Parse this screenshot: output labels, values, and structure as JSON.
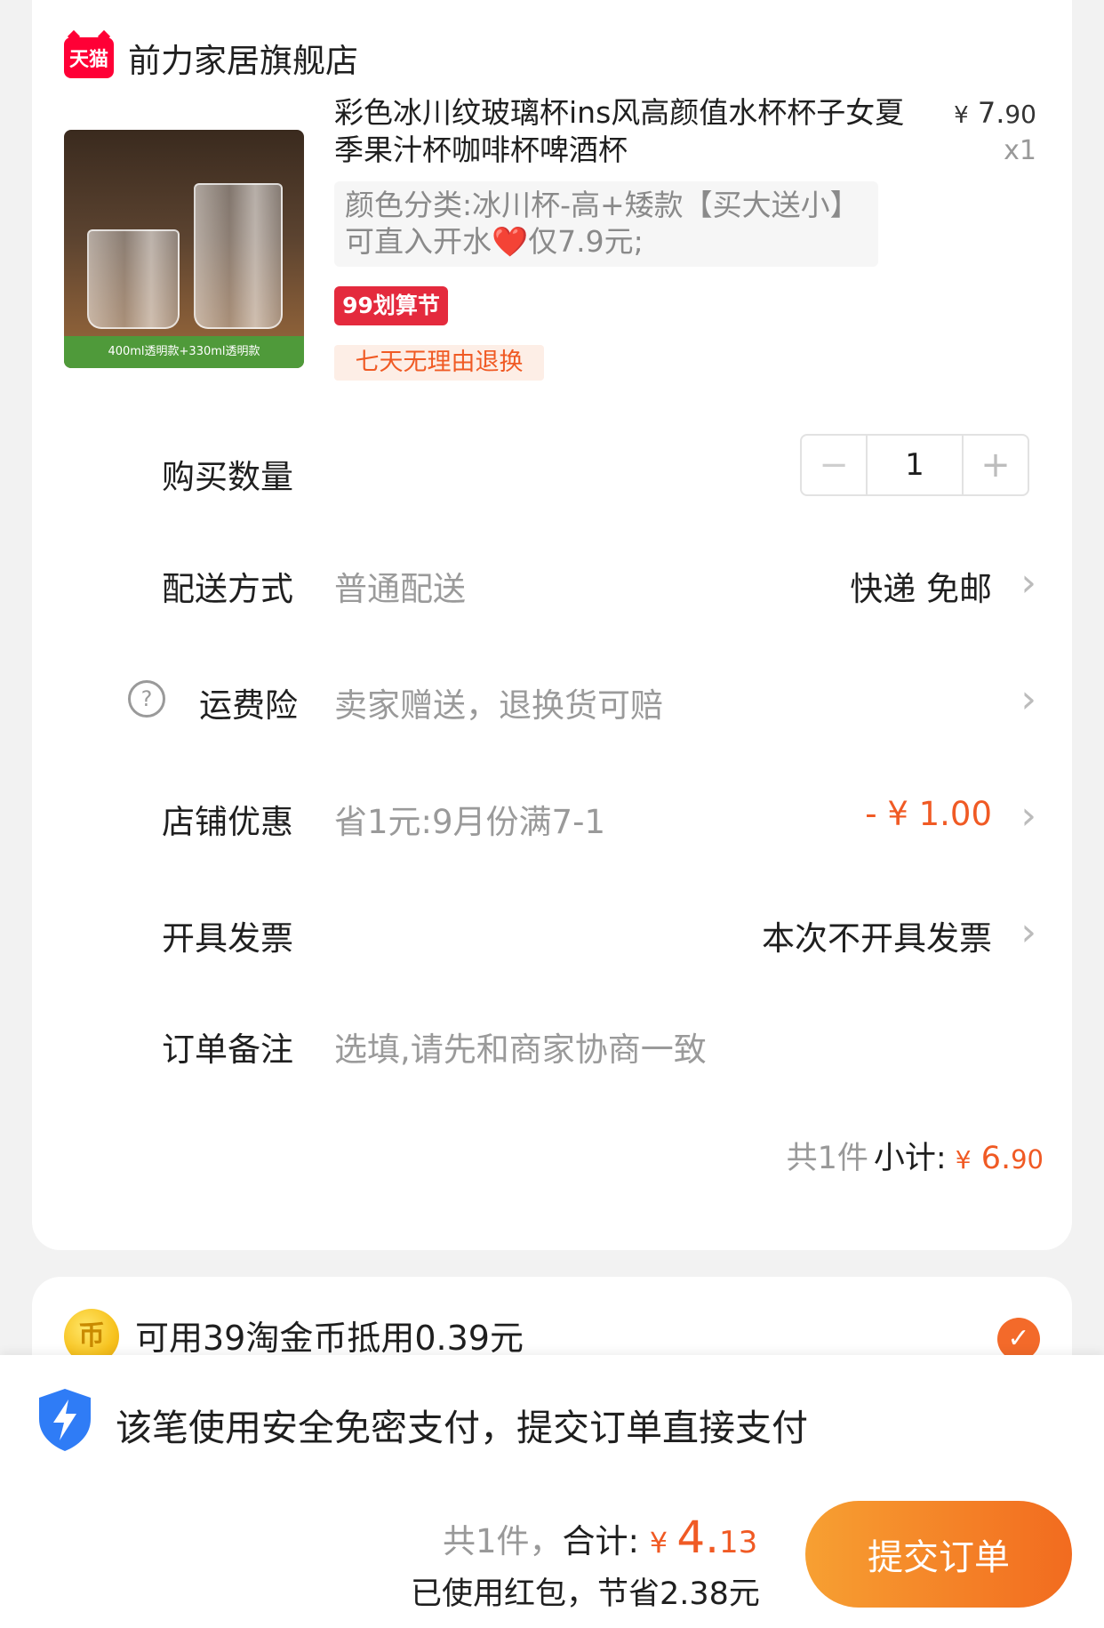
{
  "store": {
    "badge": "天猫",
    "name": "前力家居旗舰店"
  },
  "product": {
    "image_caption": "400ml透明款+330ml透明款",
    "title": "彩色冰川纹玻璃杯ins风高颜值水杯杯子女夏季果汁杯咖啡杯啤酒杯",
    "price_currency": "¥",
    "price_int": "7.",
    "price_cents": "90",
    "quantity": "x1",
    "sku": "颜色分类:冰川杯-高+矮款【买大送小】可直入开水❤️仅7.9元;",
    "tag_festival": "99划算节",
    "tag_return": "七天无理由退换"
  },
  "rows": {
    "qty_label": "购买数量",
    "qty_minus": "−",
    "qty_value": "1",
    "qty_plus": "+",
    "delivery_label": "配送方式",
    "delivery_value": "普通配送",
    "delivery_right": "快递 免邮",
    "insurance_icon": "?",
    "insurance_label": "运费险",
    "insurance_value": "卖家赠送，退换货可赔",
    "discount_label": "店铺优惠",
    "discount_value": "省1元:9月份满7-1",
    "discount_right": "- ¥ 1.00",
    "invoice_label": "开具发票",
    "invoice_right": "本次不开具发票",
    "note_label": "订单备注",
    "note_placeholder": "选填,请先和商家协商一致",
    "chevron": "›"
  },
  "subtotal": {
    "count": "共1件",
    "label": "小计:",
    "currency": "¥",
    "int": "6.",
    "cents": "90"
  },
  "coins": {
    "icon_glyph": "币",
    "text": "可用39淘金币抵用0.39元",
    "check": "✓"
  },
  "bottom": {
    "secure_text": "该笔使用安全免密支付，提交订单直接支付",
    "count": "共1件，",
    "total_label": "合计:",
    "currency": "¥ ",
    "total_int": "4.",
    "total_cents": "13",
    "saved": "已使用红包，节省2.38元",
    "submit": "提交订单"
  },
  "colors": {
    "accent": "#f05a24",
    "tmall_red": "#ff0036",
    "background": "#f2f2f2"
  }
}
